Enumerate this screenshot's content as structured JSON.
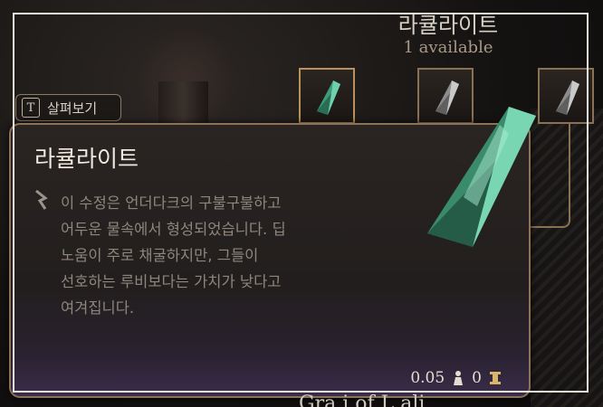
{
  "header": {
    "item_name": "라큘라이트",
    "available": "1 available"
  },
  "inspect_button": {
    "key": "T",
    "label": "살펴보기"
  },
  "tooltip": {
    "title": "라큘라이트",
    "description": "이 수정은 언더다크의 구불구불하고\n어두운 물속에서 형성되었습니다. 딥\n노움이 주로 채굴하지만, 그들이\n선호하는 루비보다는 가치가 낮다고\n여겨집니다.",
    "weight": "0.05",
    "value": "0"
  },
  "bottom_partial_text": "Gra         i   of L   ali",
  "icons": {
    "slot1": "crystal-green-icon",
    "slot2": "crystal-grey-icon",
    "slot3": "crystal-grey-icon",
    "weight": "weight-icon",
    "gold": "coin-icon"
  }
}
